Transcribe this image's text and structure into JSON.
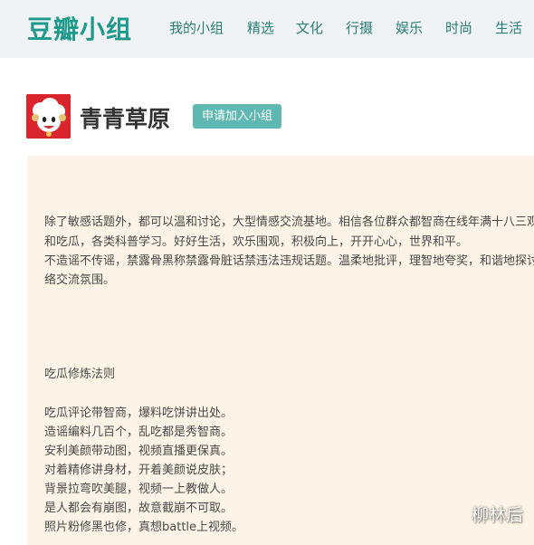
{
  "brand": "豆瓣小组",
  "nav": [
    "我的小组",
    "精选",
    "文化",
    "行摄",
    "娱乐",
    "时尚",
    "生活"
  ],
  "group": {
    "title": "青青草原",
    "join_label": "申请加入小组"
  },
  "description": {
    "intro_lines": [
      "除了敏感话题外，都可以温和讨论，大型情感交流基地。相信各位群众都智商在线年满十八三观",
      "和吃瓜，各类科普学习。好好生活，欢乐围观，积极向上，开开心心，世界和平。",
      "不造谣不传谣，禁露骨黑称禁露骨脏话禁违法违规话题。温柔地批评，理智地夸奖，和谐地探讨",
      "络交流氛围。"
    ],
    "rules_heading": "吃瓜修炼法则",
    "rules_lines": [
      "吃瓜评论带智商，爆料吃饼讲出处。",
      "造谣编料几百个，乱吃都是秀智商。",
      "安利美颜带动图，视频直播更保真。",
      "对着精修讲身材，开着美颜说皮肤；",
      "背景拉弯吹美腿，视频一上教做人。",
      "是人都会有崩图，故意截崩不可取。",
      "照片粉修黑也修，真想battle上视频。"
    ]
  },
  "watermark": "柳林后"
}
